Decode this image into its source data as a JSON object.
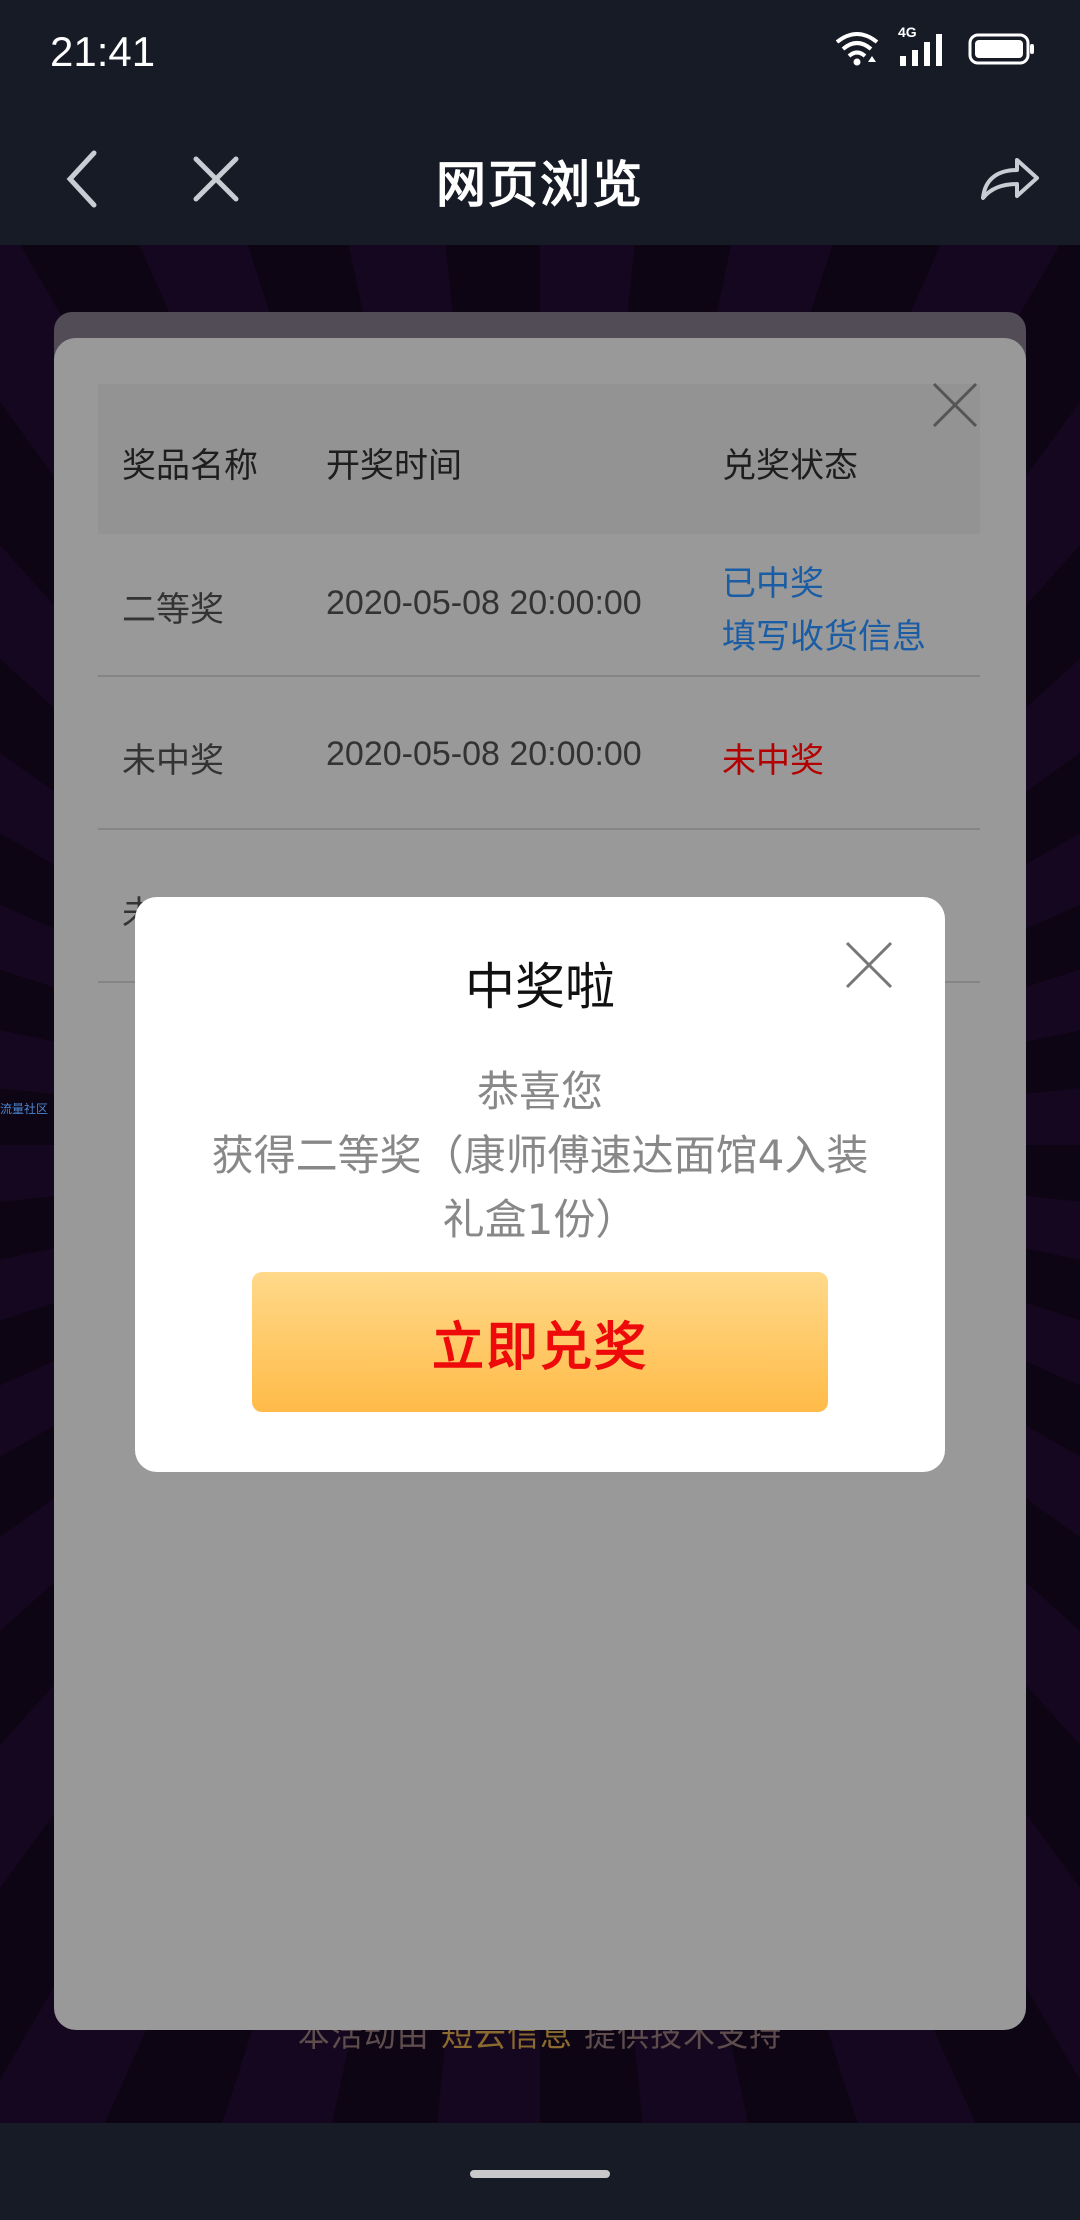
{
  "status_bar": {
    "time": "21:41",
    "network": "4G"
  },
  "nav": {
    "title": "网页浏览"
  },
  "background": {
    "side_tag": "流量社区",
    "footer_prefix": "本活动由",
    "footer_highlight": "短云信息",
    "footer_suffix": "提供技术支持"
  },
  "records": {
    "headers": [
      "奖品名称",
      "开奖时间",
      "兑奖状态"
    ],
    "rows": [
      {
        "prize": "二等奖",
        "time": "2020-05-08 20:00:00",
        "status": "已中奖",
        "action": "填写收货信息"
      },
      {
        "prize": "未中奖",
        "time": "2020-05-08 20:00:00",
        "status": "未中奖"
      },
      {
        "prize": "未"
      }
    ]
  },
  "modal": {
    "title": "中奖啦",
    "line1": "恭喜您",
    "line2": "获得二等奖（康师傅速达面馆4入装",
    "line3": "礼盒1份）",
    "button": "立即兑奖"
  },
  "colors": {
    "button_gradient_top": "#ffd98a",
    "button_gradient_bottom": "#ffbb48",
    "button_text": "#ee0a0a",
    "link_blue": "#1a5da5",
    "status_red": "#b30000"
  }
}
